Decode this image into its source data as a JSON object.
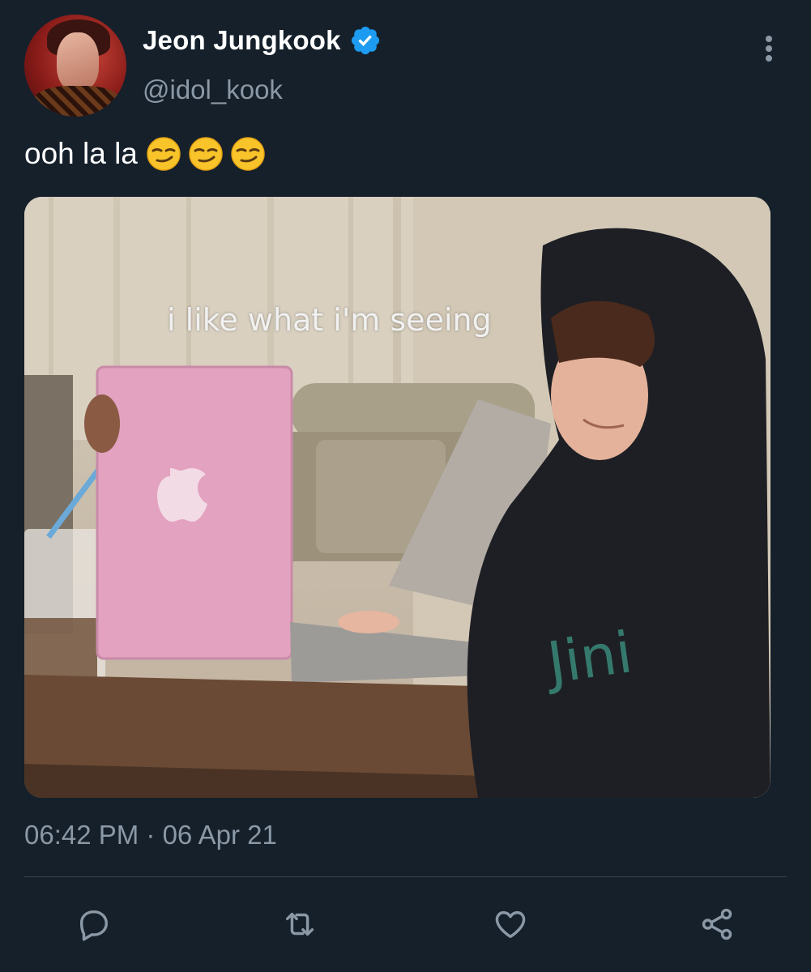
{
  "tweet": {
    "display_name": "Jeon Jungkook",
    "handle": "@idol_kook",
    "text": "ooh la la",
    "emojis": [
      "smirking-face",
      "smirking-face",
      "smirking-face"
    ],
    "media_caption": "i like what i'm seeing",
    "timestamp": "06:42 PM · 06 Apr 21"
  },
  "icons": {
    "verified": "verified-badge-icon",
    "more": "more-vertical-icon",
    "reply": "reply-icon",
    "retweet": "retweet-icon",
    "like": "like-icon",
    "share": "share-icon"
  },
  "colors": {
    "background": "#15202b",
    "secondary_text": "#8b98a5",
    "verified_blue": "#1d9bf0",
    "divider": "#38444d"
  }
}
